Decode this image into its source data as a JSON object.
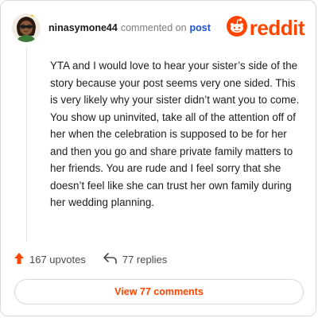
{
  "header": {
    "username": "ninasymone44",
    "commented_on": "commented on",
    "post_link": "post",
    "brand": "reddit"
  },
  "comment": {
    "text": "YTA and I would love to hear your sister’s side of the story because your post seems very one sided. This is very likely why your sister didn’t want you to come. You show up uninvited, take all of the attention off of her when the celebration is supposed to be for her and then you go and share private family matters to her friends. You are rude and I feel sorry that she doesn’t feel like she can trust her own family during her wedding planning."
  },
  "actions": {
    "upvotes": "167 upvotes",
    "replies": "77 replies"
  },
  "view_comments": "View 77 comments",
  "colors": {
    "brand": "#ff4500",
    "link": "#1a4fd6"
  },
  "icons": [
    "avatar",
    "reddit-snoo-icon",
    "upvote-arrow-icon",
    "reply-arrow-icon"
  ]
}
